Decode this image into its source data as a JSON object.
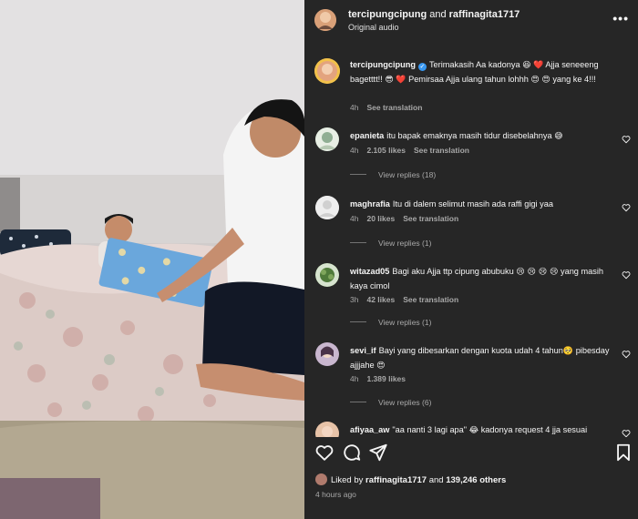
{
  "header": {
    "user1": "tercipungcipung",
    "and_text": "and",
    "user2": "raffinagita1717",
    "subtitle": "Original audio",
    "more_label": "•••"
  },
  "caption": {
    "username": "tercipungcipung",
    "text_a": "Terimakasih Aa kadonya",
    "text_b": "Ajja seneeeng bagetttt!!",
    "text_c": "Pemirsaa Ajja ulang tahun lohhh",
    "text_d": "yang ke 4!!!",
    "time": "4h",
    "see_translation": "See translation"
  },
  "comments": [
    {
      "username": "epanieta",
      "text": "itu bapak emaknya masih tidur disebelahnya",
      "emoji": "😅",
      "time": "4h",
      "likes": "2.105 likes",
      "see_translation": "See translation",
      "replies": "View replies (18)",
      "avatar_color": "#9fb7a0"
    },
    {
      "username": "maghrafia",
      "text": "Itu di dalem selimut masih ada raffi gigi yaa",
      "emoji": "",
      "time": "4h",
      "likes": "20 likes",
      "see_translation": "See translation",
      "replies": "View replies (1)",
      "avatar_color": "#f2f2f2"
    },
    {
      "username": "witazad05",
      "text": "Bagi aku Ajja ttp cipung abubuku",
      "emoji": "😢 😢 😢 😢",
      "text2": "yang masih kaya cimol",
      "time": "3h",
      "likes": "42 likes",
      "see_translation": "See translation",
      "replies": "View replies (1)",
      "avatar_color": "#4f7a3a"
    },
    {
      "username": "sevi_if",
      "text": "Bayi yang dibesarkan dengan kuota udah 4 tahun",
      "emoji": "🥺",
      "text2": "pibesday ajjjahe",
      "emoji2": "😍",
      "time": "4h",
      "likes": "1.389 likes",
      "replies": "View replies (6)",
      "avatar_color": "#8a6f8e"
    },
    {
      "username": "afiyaa_aw",
      "text": "\"aa nanti 3 lagi apa\"",
      "emoji": "😂",
      "text2": "kadonya request 4 jja sesuai",
      "avatar_color": "#c99a7a"
    }
  ],
  "likes_line": {
    "prefix": "Liked by",
    "user": "raffinagita1717",
    "and_text": "and",
    "count": "139,246 others"
  },
  "posted_time": "4 hours ago",
  "colors": {
    "pane_bg": "#262626",
    "verified": "#3897f0",
    "muted_text": "#a8a8a8",
    "heart_red": "#ed4956"
  },
  "icons": {
    "caption_emoji_1": "😆",
    "caption_emoji_2": "❤️",
    "caption_emoji_3": "😎",
    "caption_emoji_4": "❤️",
    "caption_emoji_5": "😍",
    "caption_emoji_6": "😍",
    "verified_mark": "✓"
  }
}
